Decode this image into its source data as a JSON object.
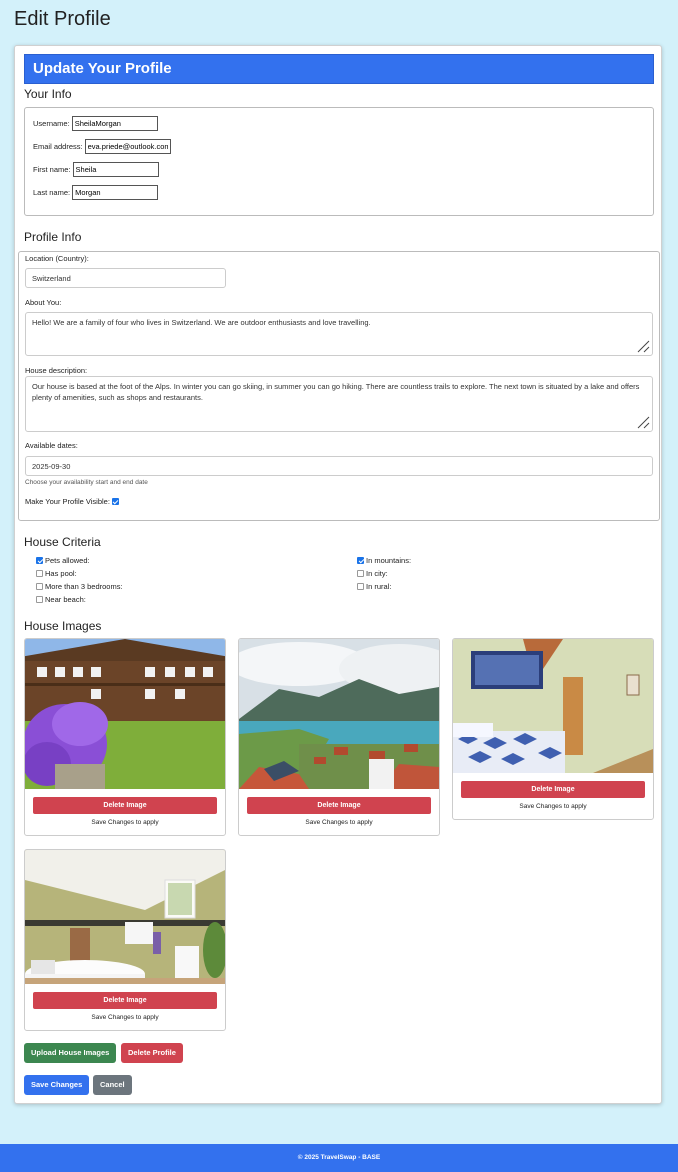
{
  "page": {
    "title": "Edit Profile"
  },
  "card": {
    "header": "Update Your Profile"
  },
  "your_info": {
    "title": "Your Info",
    "username_label": "Username:",
    "username_value": "SheilaMorgan",
    "email_label": "Email address:",
    "email_value": "eva.priede@outlook.com",
    "first_name_label": "First name:",
    "first_name_value": "Sheila",
    "last_name_label": "Last name:",
    "last_name_value": "Morgan"
  },
  "profile_info": {
    "title": "Profile Info",
    "location_label": "Location (Country):",
    "location_value": "Switzerland",
    "about_label": "About You:",
    "about_value": "Hello! We are a family of four who lives in Switzerland. We are outdoor enthusiasts and love travelling.",
    "house_desc_label": "House description:",
    "house_desc_value": "Our house is based at the foot of the Alps. In winter you can go skiing, in summer  you can go hiking. There are countless trails to explore. The next town is situated by a lake and offers plenty of amenities, such as shops and restaurants.",
    "dates_label": "Available dates:",
    "dates_value": "2025-09-30",
    "dates_hint": "Choose your availability start and end date",
    "visible_label": "Make Your Profile Visible:",
    "visible_checked": true
  },
  "house_criteria": {
    "title": "House Criteria",
    "left": [
      {
        "label": "Pets allowed:",
        "checked": true
      },
      {
        "label": "Has pool:",
        "checked": false
      },
      {
        "label": "More than 3 bedrooms:",
        "checked": false
      },
      {
        "label": "Near beach:",
        "checked": false
      }
    ],
    "right": [
      {
        "label": "In mountains:",
        "checked": true
      },
      {
        "label": "In city:",
        "checked": false
      },
      {
        "label": "In rural:",
        "checked": false
      }
    ]
  },
  "house_images": {
    "title": "House Images",
    "delete_label": "Delete Image",
    "note": "Save Changes to apply"
  },
  "actions": {
    "upload": "Upload House Images",
    "delete_profile": "Delete Profile",
    "save": "Save Changes",
    "cancel": "Cancel"
  },
  "colors": {
    "primary": "#3371ee",
    "danger": "#d0434f",
    "success": "#3c8750",
    "secondary": "#6c757d",
    "background": "#d3f1fa"
  },
  "footer": {
    "text": "© 2025 TravelSwap - BASE"
  }
}
